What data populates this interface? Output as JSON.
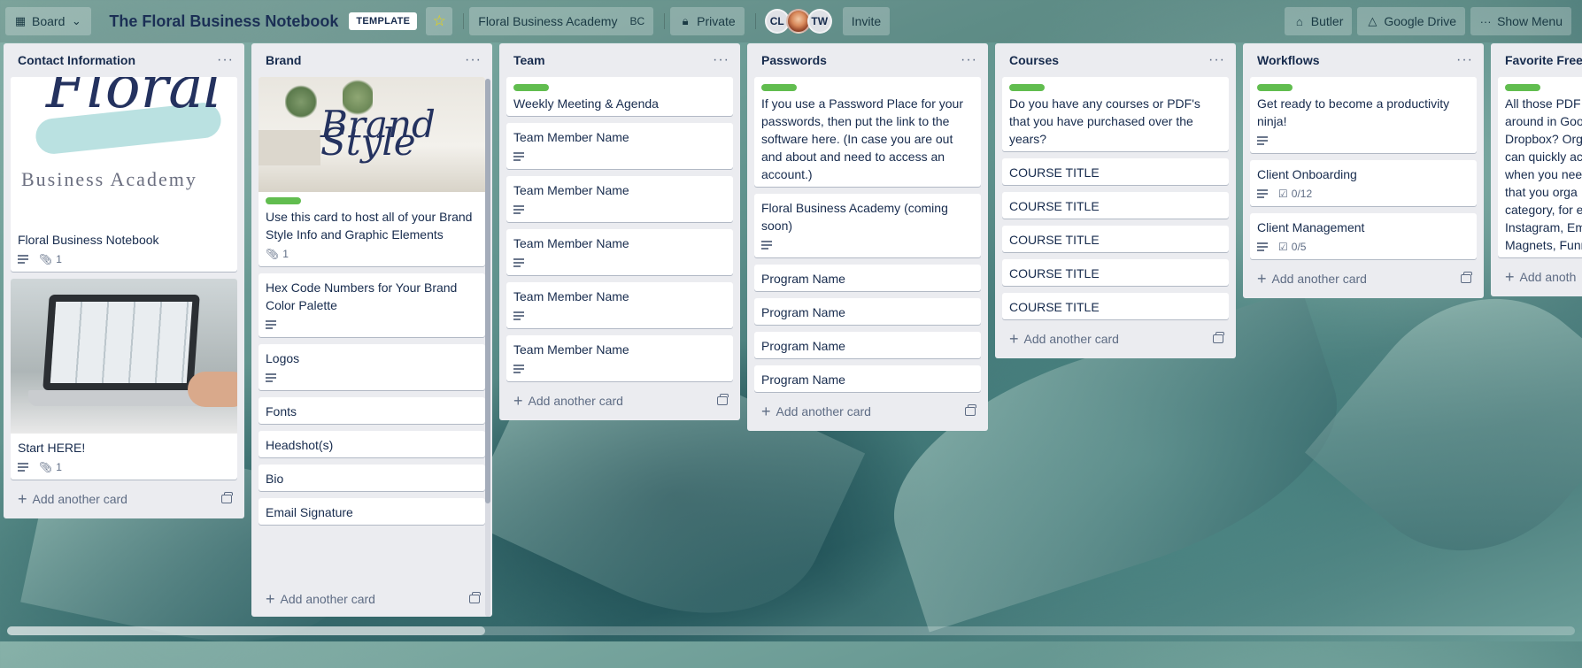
{
  "header": {
    "view_label": "Board",
    "board_title": "The Floral Business Notebook",
    "template_badge": "TEMPLATE",
    "workspace_name": "Floral Business Academy",
    "workspace_code": "BC",
    "visibility": "Private",
    "members": [
      "CL",
      "",
      "TW"
    ],
    "invite_label": "Invite",
    "butler_label": "Butler",
    "google_drive_label": "Google Drive",
    "show_menu_label": "Show Menu"
  },
  "add_card_label": "Add another card",
  "lists": {
    "contact": {
      "title": "Contact Information",
      "cards": [
        {
          "title": "Floral Business Notebook",
          "attachments": "1",
          "cover_text_1": "Floral",
          "cover_text_2": "Business Academy"
        },
        {
          "title": "Start HERE!",
          "attachments": "1"
        }
      ]
    },
    "brand": {
      "title": "Brand",
      "cards": [
        {
          "title": "Use this card to host all of your Brand Style Info and Graphic Elements",
          "attachments": "1",
          "cover_text": "Brand Style"
        },
        {
          "title": "Hex Code Numbers for Your Brand Color Palette"
        },
        {
          "title": "Logos"
        },
        {
          "title": "Fonts"
        },
        {
          "title": "Headshot(s)"
        },
        {
          "title": "Bio"
        },
        {
          "title": "Email Signature"
        }
      ]
    },
    "team": {
      "title": "Team",
      "cards": [
        {
          "title": "Weekly Meeting & Agenda"
        },
        {
          "title": "Team Member Name"
        },
        {
          "title": "Team Member Name"
        },
        {
          "title": "Team Member Name"
        },
        {
          "title": "Team Member Name"
        },
        {
          "title": "Team Member Name"
        }
      ]
    },
    "passwords": {
      "title": "Passwords",
      "cards": [
        {
          "title": "If you use a Password Place for your passwords, then put the link to the software here. (In case you are out and about and need to access an account.)"
        },
        {
          "title": "Floral Business Academy (coming soon)"
        },
        {
          "title": "Program Name"
        },
        {
          "title": "Program Name"
        },
        {
          "title": "Program Name"
        },
        {
          "title": "Program Name"
        }
      ]
    },
    "courses": {
      "title": "Courses",
      "cards": [
        {
          "title": "Do you have any courses or PDF's that you have purchased over the years?"
        },
        {
          "title": "COURSE TITLE"
        },
        {
          "title": "COURSE TITLE"
        },
        {
          "title": "COURSE TITLE"
        },
        {
          "title": "COURSE TITLE"
        },
        {
          "title": "COURSE TITLE"
        }
      ]
    },
    "workflows": {
      "title": "Workflows",
      "cards": [
        {
          "title": "Get ready to become a productivity ninja!"
        },
        {
          "title": "Client Onboarding",
          "checklist": "0/12"
        },
        {
          "title": "Client Management",
          "checklist": "0/5"
        }
      ]
    },
    "freebies": {
      "title": "Favorite Freeb",
      "cards": [
        {
          "line_1": "All those PDF",
          "line_2": "around in Goo",
          "line_3": "Dropbox? Org",
          "line_4": "can quickly ac",
          "line_5": "when you nee",
          "line_6": "that you orga",
          "line_7": "category, for e",
          "line_8": "Instagram, Em",
          "line_9": "Magnets, Funr"
        }
      ],
      "add_label": "Add anoth"
    }
  },
  "colors": {
    "label_green": "#61bd4f",
    "list_bg": "#ebecf0",
    "title_navy": "#1b2f55"
  }
}
